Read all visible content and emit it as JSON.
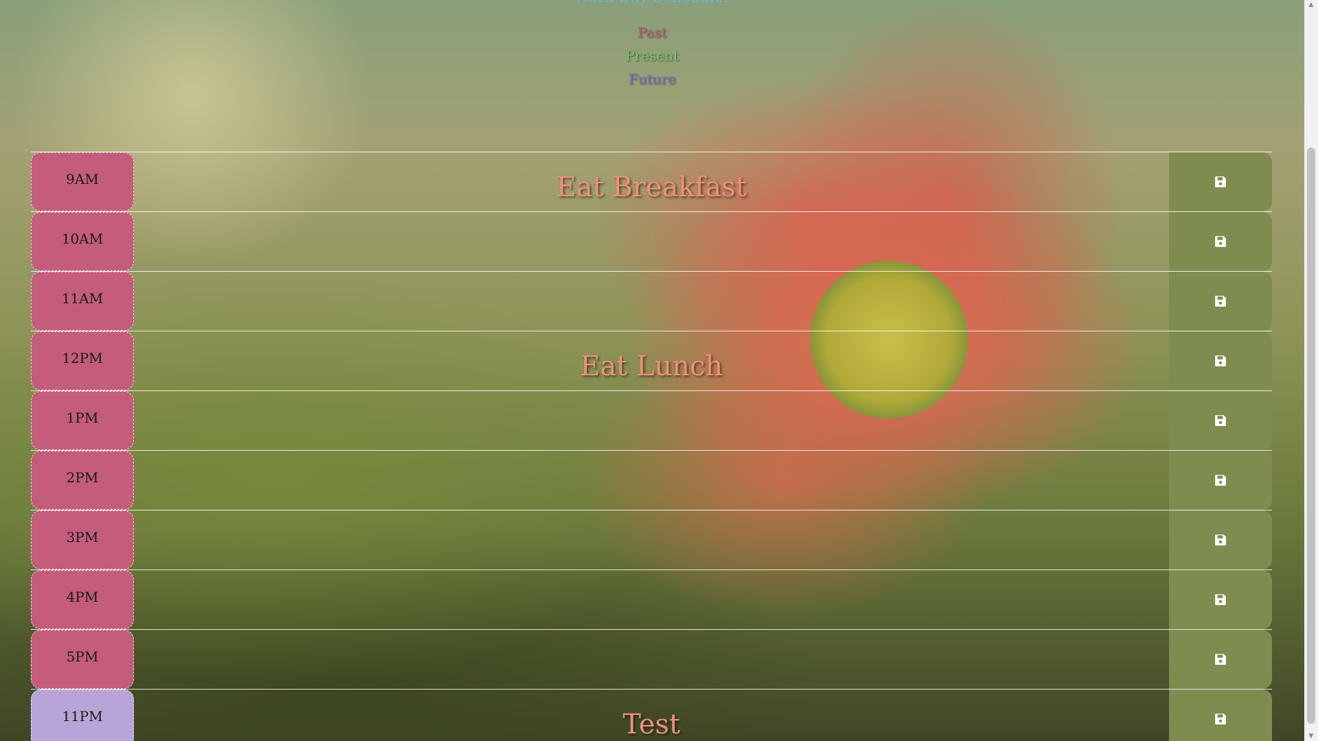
{
  "header": {
    "title": "Work Day Scheduler"
  },
  "legend": {
    "past": "Past",
    "present": "Present",
    "future": "Future"
  },
  "colors": {
    "past": "#c45c7c",
    "present": "#7fc26e",
    "future": "#b8a4d6",
    "save": "#7f8c50",
    "event_text": "#f08f78"
  },
  "rows": [
    {
      "hour": "9AM",
      "text": "Eat Breakfast",
      "state": "past"
    },
    {
      "hour": "10AM",
      "text": "",
      "state": "past"
    },
    {
      "hour": "11AM",
      "text": "",
      "state": "past"
    },
    {
      "hour": "12PM",
      "text": "Eat Lunch",
      "state": "past"
    },
    {
      "hour": "1PM",
      "text": "",
      "state": "past"
    },
    {
      "hour": "2PM",
      "text": "",
      "state": "past"
    },
    {
      "hour": "3PM",
      "text": "",
      "state": "past"
    },
    {
      "hour": "4PM",
      "text": "",
      "state": "past"
    },
    {
      "hour": "5PM",
      "text": "",
      "state": "past"
    },
    {
      "hour": "11PM",
      "text": "Test",
      "state": "future"
    }
  ],
  "save_icon": "floppy-disk-icon"
}
